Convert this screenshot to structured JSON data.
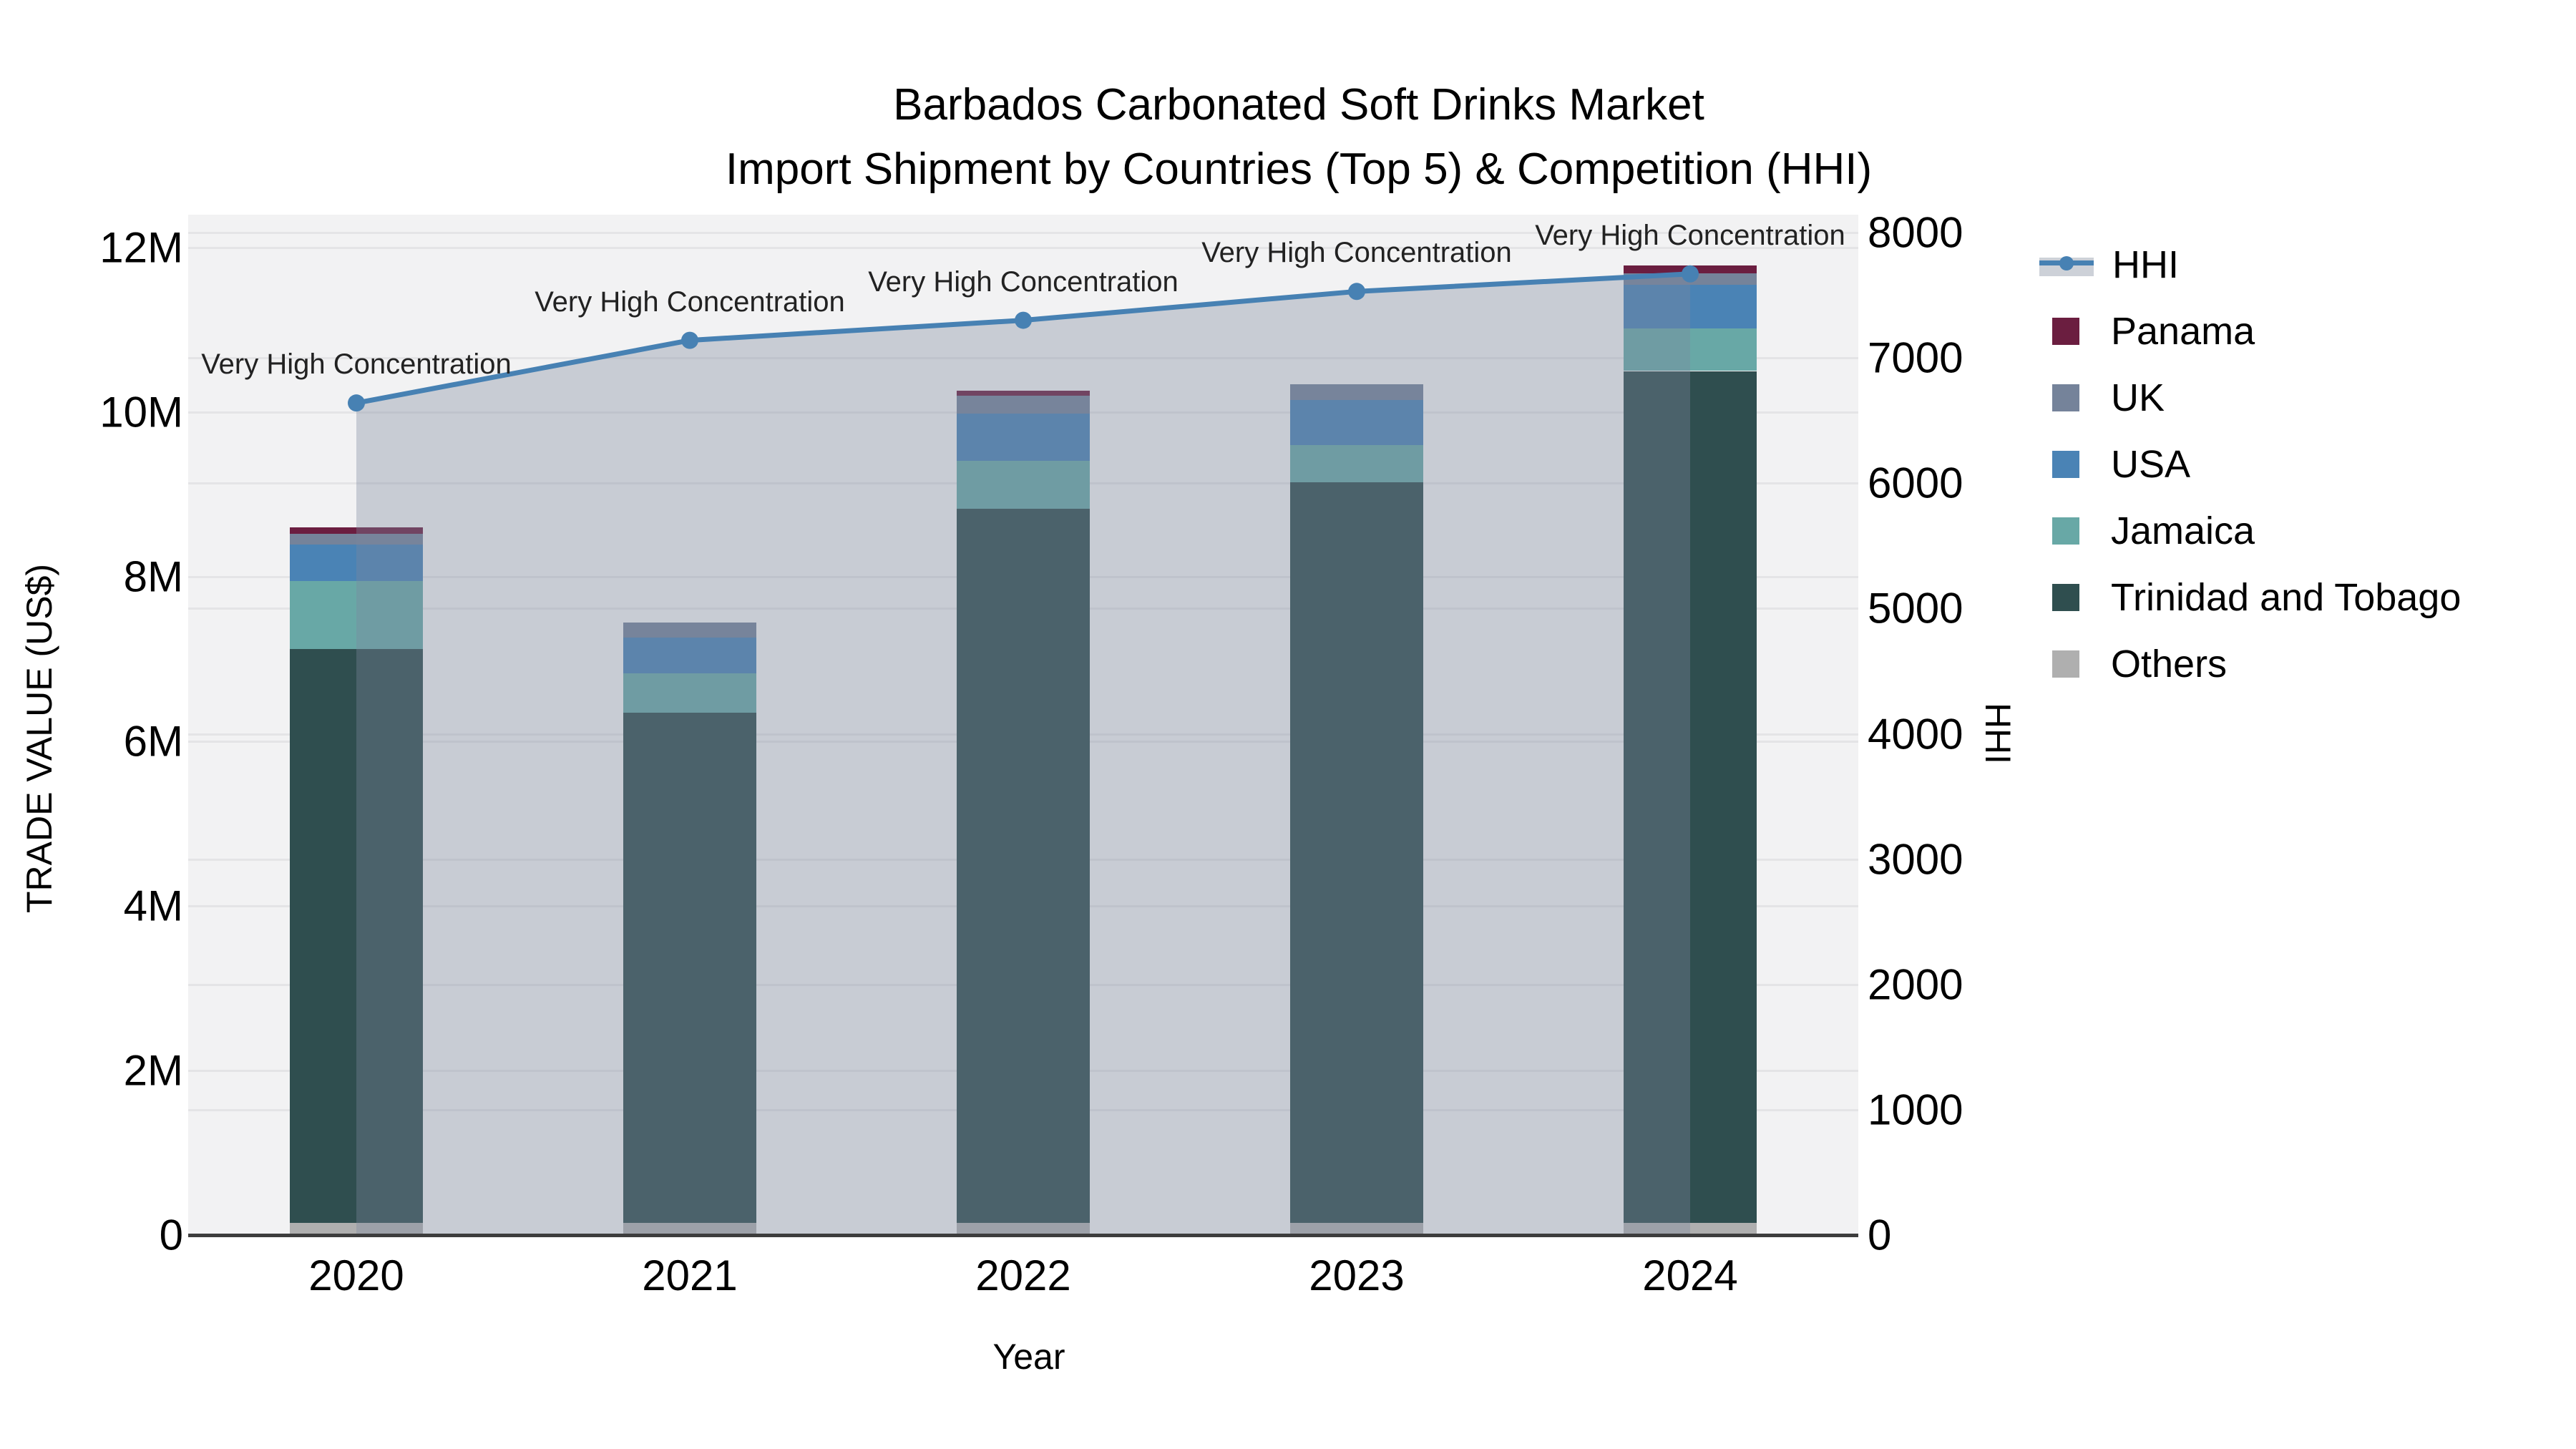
{
  "title": {
    "line1": "Barbados Carbonated Soft Drinks Market",
    "line2": "Import Shipment by Countries (Top 5) & Competition (HHI)"
  },
  "axes": {
    "x": {
      "title": "Year",
      "tick_labels": [
        "2020",
        "2021",
        "2022",
        "2023",
        "2024"
      ]
    },
    "y_left": {
      "title": "TRADE VALUE (US$)",
      "tick_labels": [
        "0",
        "2M",
        "4M",
        "6M",
        "8M",
        "10M",
        "12M"
      ],
      "tick_values": [
        0,
        2000000,
        4000000,
        6000000,
        8000000,
        10000000,
        12000000
      ],
      "range": [
        0,
        12400000
      ]
    },
    "y_right": {
      "title": "HHI",
      "tick_labels": [
        "0",
        "1000",
        "2000",
        "3000",
        "4000",
        "5000",
        "6000",
        "7000",
        "8000"
      ],
      "tick_values": [
        0,
        1000,
        2000,
        3000,
        4000,
        5000,
        6000,
        7000,
        8000
      ],
      "range": [
        0,
        8143
      ]
    }
  },
  "legend": [
    {
      "label": "HHI",
      "type": "line",
      "color": "#4781B3"
    },
    {
      "label": "Panama",
      "type": "square",
      "color": "#6B1E40"
    },
    {
      "label": "UK",
      "type": "square",
      "color": "#75839A"
    },
    {
      "label": "USA",
      "type": "square",
      "color": "#4A83B5"
    },
    {
      "label": "Jamaica",
      "type": "square",
      "color": "#68A8A6"
    },
    {
      "label": "Trinidad and Tobago",
      "type": "square",
      "color": "#2F4E4F"
    },
    {
      "label": "Others",
      "type": "square",
      "color": "#AFAFAF"
    }
  ],
  "colors": {
    "plot_background": "#f2f2f3",
    "gridline": "#e4e4e6",
    "axis_line": "#3d3d3d",
    "hhi_line": "#4781B3",
    "hhi_area_fill": "rgba(125,137,157,0.36)",
    "annotation_text": "#222222"
  },
  "chart_data": {
    "type": "bar+line",
    "title": "Barbados Carbonated Soft Drinks Market — Import Shipment by Countries (Top 5) & Competition (HHI)",
    "xlabel": "Year",
    "ylabel_left": "TRADE VALUE (US$)",
    "ylabel_right": "HHI",
    "categories": [
      "2020",
      "2021",
      "2022",
      "2023",
      "2024"
    ],
    "stack_order_bottom_to_top": [
      "Others",
      "Trinidad and Tobago",
      "Jamaica",
      "USA",
      "UK",
      "Panama"
    ],
    "series": [
      {
        "name": "Others",
        "color": "#AFAFAF",
        "values": [
          150000,
          150000,
          150000,
          150000,
          150000
        ]
      },
      {
        "name": "Trinidad and Tobago",
        "color": "#2F4E4F",
        "values": [
          6970000,
          6200000,
          8680000,
          9000000,
          10350000
        ]
      },
      {
        "name": "Jamaica",
        "color": "#68A8A6",
        "values": [
          830000,
          480000,
          580000,
          450000,
          520000
        ]
      },
      {
        "name": "USA",
        "color": "#4A83B5",
        "values": [
          440000,
          430000,
          570000,
          550000,
          530000
        ]
      },
      {
        "name": "UK",
        "color": "#75839A",
        "values": [
          130000,
          180000,
          220000,
          190000,
          140000
        ]
      },
      {
        "name": "Panama",
        "color": "#6B1E40",
        "values": [
          80000,
          0,
          60000,
          0,
          90000
        ]
      }
    ],
    "bar_totals": [
      8600000,
      7440000,
      10260000,
      10340000,
      11780000
    ],
    "line": {
      "name": "HHI",
      "axis": "right",
      "values": [
        6640,
        7140,
        7300,
        7530,
        7670
      ]
    },
    "point_annotations": [
      "Very High Concentration",
      "Very High Concentration",
      "Very High Concentration",
      "Very High Concentration",
      "Very High Concentration"
    ],
    "grid": "both-axes",
    "legend_position": "right-outside"
  }
}
